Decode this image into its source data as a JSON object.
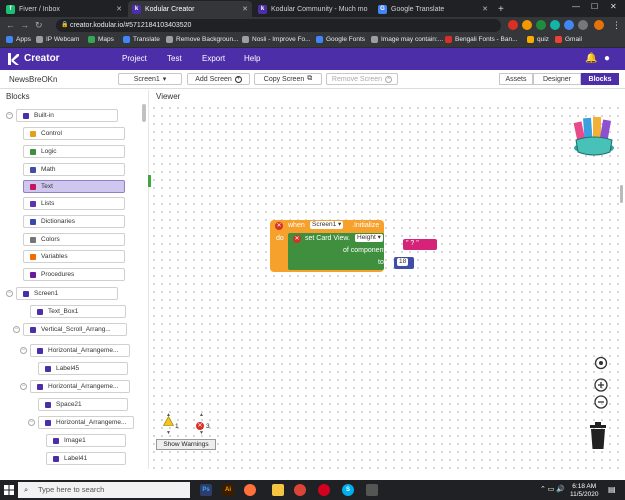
{
  "browser": {
    "tabs": [
      {
        "label": "Fiverr / Inbox",
        "color": "#1dbf73",
        "glyph": "f"
      },
      {
        "label": "Kodular Creator",
        "color": "#4b2ea8",
        "glyph": "k",
        "active": true
      },
      {
        "label": "Kodular Community - Much mo",
        "color": "#4b2ea8",
        "glyph": "k"
      },
      {
        "label": "Google Translate",
        "color": "#4285f4",
        "glyph": "G"
      }
    ],
    "new_tab": "+",
    "url": "creator.kodular.io/#5712184103403520",
    "bookmarks": [
      "Apps",
      "IP Webcam",
      "Maps",
      "Translate",
      "Remove Backgroun...",
      "Nosli - Improve Fo...",
      "Google Fonts",
      "Image may contain:...",
      "Bengali Fonts - Ban...",
      "quiz",
      "Gmail"
    ]
  },
  "header": {
    "title": "Creator",
    "menu": [
      "Project",
      "Test",
      "Export",
      "Help"
    ]
  },
  "toolbar": {
    "project_name": "NewsBreOKn",
    "screen_select": "Screen1",
    "add_screen": "Add Screen",
    "copy_screen": "Copy Screen",
    "remove_screen": "Remove Screen",
    "modes": [
      "Assets",
      "Designer",
      "Blocks"
    ],
    "active_mode": "Blocks"
  },
  "panels": {
    "blocks": "Blocks",
    "viewer": "Viewer"
  },
  "tree": [
    {
      "label": "Built-in",
      "color": "#4b2ea8"
    },
    {
      "label": "Control",
      "color": "#e0a21a"
    },
    {
      "label": "Logic",
      "color": "#3f8f3f"
    },
    {
      "label": "Math",
      "color": "#3f4fa8"
    },
    {
      "label": "Text",
      "color": "#c2185b",
      "selected": true
    },
    {
      "label": "Lists",
      "color": "#5e35b1"
    },
    {
      "label": "Dictionaries",
      "color": "#3949ab"
    },
    {
      "label": "Colors",
      "color": "#757575"
    },
    {
      "label": "Variables",
      "color": "#ef6c00"
    },
    {
      "label": "Procedures",
      "color": "#6a1b9a"
    },
    {
      "label": "Screen1",
      "color": "#4b2ea8"
    },
    {
      "label": "Text_Box1",
      "color": "#4b2ea8"
    },
    {
      "label": "Vertical_Scroll_Arrang...",
      "color": "#4b2ea8"
    },
    {
      "label": "Horizontal_Arrangeme...",
      "color": "#4b2ea8"
    },
    {
      "label": "Label45",
      "color": "#4b2ea8"
    },
    {
      "label": "Horizontal_Arrangeme...",
      "color": "#4b2ea8"
    },
    {
      "label": "Space21",
      "color": "#4b2ea8"
    },
    {
      "label": "Horizontal_Arrangeme...",
      "color": "#4b2ea8"
    },
    {
      "label": "Image1",
      "color": "#4b2ea8"
    },
    {
      "label": "Label41",
      "color": "#4b2ea8"
    }
  ],
  "blocks": {
    "event_when": "when",
    "event_component": "Screen1",
    "event_name": ".Initialize",
    "do_label": "do",
    "setter_prefix": "set Card View.",
    "setter_property": "Height",
    "of_component": "of component",
    "to_label": "to",
    "text_value": "\" ? \"",
    "number_value": "18"
  },
  "warnings": {
    "warning_count": "1",
    "error_count": "3",
    "show_label": "Show Warnings"
  },
  "taskbar": {
    "search_placeholder": "Type here to search",
    "time": "6:18 AM",
    "date": "11/5/2020"
  }
}
